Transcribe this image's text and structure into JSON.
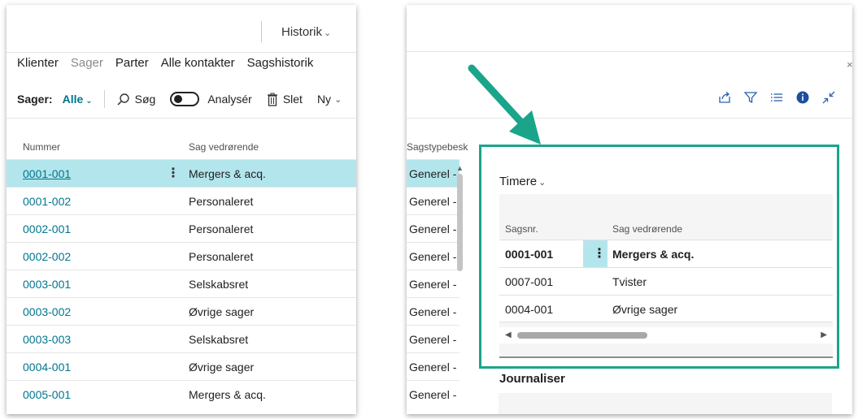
{
  "topbar": {
    "historik_label": "Historik"
  },
  "nav": {
    "tabs": [
      "Klienter",
      "Sager",
      "Parter",
      "Alle kontakter",
      "Sagshistorik"
    ]
  },
  "actions": {
    "filter_label": "Sager:",
    "filter_value": "Alle",
    "search_label": "Søg",
    "analyze_label": "Analysér",
    "delete_label": "Slet",
    "new_label": "Ny"
  },
  "grid": {
    "col_nummer": "Nummer",
    "col_sag": "Sag vedrørende",
    "col_sagtype": "Sagstypebesk",
    "rows": [
      {
        "nummer": "0001-001",
        "sag": "Mergers & acq.",
        "type": "Generel -"
      },
      {
        "nummer": "0001-002",
        "sag": "Personaleret",
        "type": "Generel -"
      },
      {
        "nummer": "0002-001",
        "sag": "Personaleret",
        "type": "Generel -"
      },
      {
        "nummer": "0002-002",
        "sag": "Personaleret",
        "type": "Generel -"
      },
      {
        "nummer": "0003-001",
        "sag": "Selskabsret",
        "type": "Generel -"
      },
      {
        "nummer": "0003-002",
        "sag": "Øvrige sager",
        "type": "Generel -"
      },
      {
        "nummer": "0003-003",
        "sag": "Selskabsret",
        "type": "Generel -"
      },
      {
        "nummer": "0004-001",
        "sag": "Øvrige sager",
        "type": "Generel -"
      },
      {
        "nummer": "0005-001",
        "sag": "Mergers & acq.",
        "type": "Generel -"
      }
    ]
  },
  "factbox": {
    "title": "Timere",
    "col_sagsnr": "Sagsnr.",
    "col_sag": "Sag vedrørende",
    "rows": [
      {
        "sagsnr": "0001-001",
        "sag": "Mergers & acq."
      },
      {
        "sagsnr": "0007-001",
        "sag": "Tvister"
      },
      {
        "sagsnr": "0004-001",
        "sag": "Øvrige sager"
      }
    ]
  },
  "journal": {
    "title": "Journaliser"
  },
  "colors": {
    "accent": "#00758f",
    "selection": "#b3e6ec",
    "highlight_border": "#1aa58b"
  }
}
